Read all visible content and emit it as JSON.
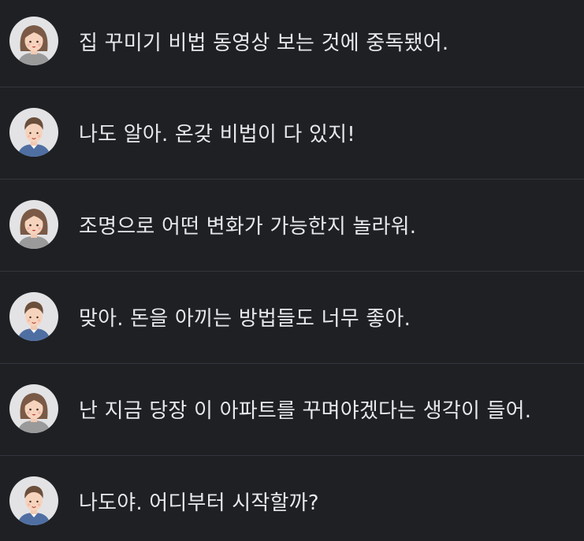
{
  "messages": [
    {
      "speaker": "female",
      "text": "집 꾸미기 비법 동영상 보는 것에 중독됐어."
    },
    {
      "speaker": "male",
      "text": "나도 알아. 온갖 비법이 다 있지!"
    },
    {
      "speaker": "female",
      "text": "조명으로 어떤 변화가 가능한지 놀라워."
    },
    {
      "speaker": "male",
      "text": "맞아. 돈을 아끼는 방법들도 너무 좋아."
    },
    {
      "speaker": "female",
      "text": "난 지금 당장 이 아파트를 꾸며야겠다는 생각이 들어."
    },
    {
      "speaker": "male",
      "text": "나도야. 어디부터 시작할까?"
    }
  ],
  "colors": {
    "background": "#1e2024",
    "divider": "#33363c",
    "text": "#e7e8ea",
    "avatar_bg": "#e3e3e5"
  },
  "icons": {
    "female": "female-avatar-icon",
    "male": "male-avatar-icon"
  }
}
